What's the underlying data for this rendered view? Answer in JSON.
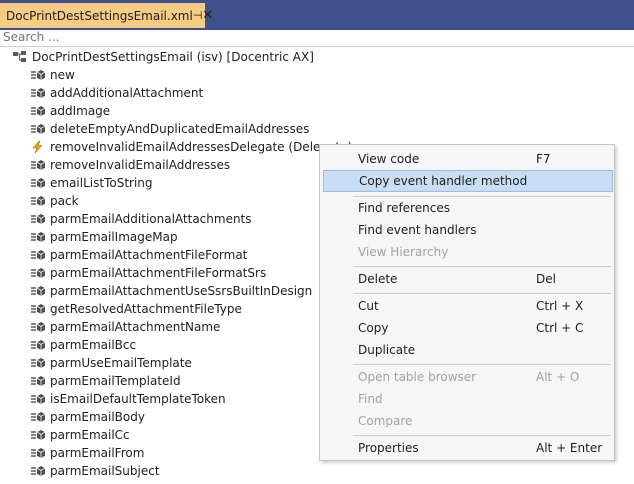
{
  "tab": {
    "title": "DocPrintDestSettingsEmail.xml",
    "pin_glyph": "⊣",
    "close_glyph": "✕"
  },
  "search": {
    "placeholder": "Search ..."
  },
  "tree": {
    "root": "DocPrintDestSettingsEmail (isv) [Docentric AX]",
    "items": [
      "new",
      "addAdditionalAttachment",
      "addImage",
      "deleteEmptyAndDuplicatedEmailAddresses",
      "removeInvalidEmailAddressesDelegate (Delegate)",
      "removeInvalidEmailAddresses",
      "emailListToString",
      "pack",
      "parmEmailAdditionalAttachments",
      "parmEmailImageMap",
      "parmEmailAttachmentFileFormat",
      "parmEmailAttachmentFileFormatSrs",
      "parmEmailAttachmentUseSsrsBuiltInDesign",
      "getResolvedAttachmentFileType",
      "parmEmailAttachmentName",
      "parmEmailBcc",
      "parmUseEmailTemplate",
      "parmEmailTemplateId",
      "isEmailDefaultTemplateToken",
      "parmEmailBody",
      "parmEmailCc",
      "parmEmailFrom",
      "parmEmailSubject"
    ]
  },
  "context_menu": {
    "items": [
      {
        "label": "View code",
        "shortcut": "F7"
      },
      {
        "label": "Copy event handler method",
        "shortcut": ""
      },
      {
        "label": "Find references",
        "shortcut": ""
      },
      {
        "label": "Find event handlers",
        "shortcut": ""
      },
      {
        "label": "View Hierarchy",
        "shortcut": ""
      },
      {
        "label": "Delete",
        "shortcut": "Del"
      },
      {
        "label": "Cut",
        "shortcut": "Ctrl + X"
      },
      {
        "label": "Copy",
        "shortcut": "Ctrl + C"
      },
      {
        "label": "Duplicate",
        "shortcut": ""
      },
      {
        "label": "Open table browser",
        "shortcut": "Alt + O"
      },
      {
        "label": "Find",
        "shortcut": ""
      },
      {
        "label": "Compare",
        "shortcut": ""
      },
      {
        "label": "Properties",
        "shortcut": "Alt + Enter"
      }
    ]
  },
  "colors": {
    "tabbar_bg": "#40508d",
    "active_tab": "#f5cc84",
    "menu_bg": "#f6f6f6",
    "menu_highlight": "#c9def5",
    "delegate_icon": "#e8a800"
  },
  "icons": {
    "root": "class-tree-icon",
    "method": "method-icon",
    "delegate": "lightning-delegate-icon"
  }
}
